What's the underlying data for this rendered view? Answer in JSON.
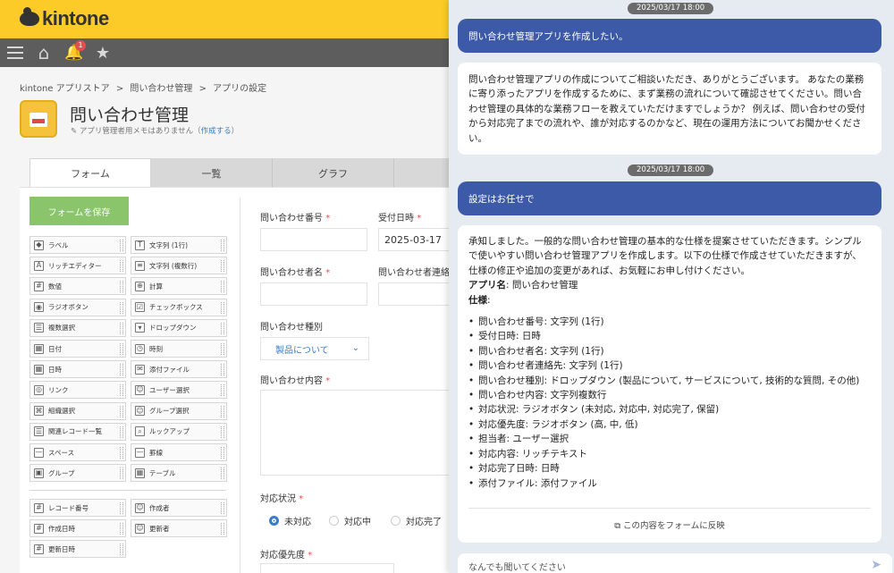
{
  "header": {
    "logo_text": "kintone",
    "notification_count": "1"
  },
  "breadcrumb": [
    "kintone アプリストア",
    ">",
    "問い合わせ管理",
    ">",
    "アプリの設定"
  ],
  "app": {
    "title": "問い合わせ管理",
    "memo": "アプリ管理者用メモはありません（",
    "memo_link": "作成する",
    "memo_end": "）"
  },
  "tabs": [
    "フォーム",
    "一覧",
    "グラフ"
  ],
  "save_button": "フォームを保存",
  "parts_left": [
    "ラベル",
    "リッチエディター",
    "数値",
    "ラジオボタン",
    "複数選択",
    "日付",
    "日時",
    "リンク",
    "組織選択",
    "関連レコード一覧",
    "スペース",
    "グループ"
  ],
  "parts_right": [
    "文字列 (1行)",
    "文字列 (複数行)",
    "計算",
    "チェックボックス",
    "ドロップダウン",
    "時刻",
    "添付ファイル",
    "ユーザー選択",
    "グループ選択",
    "ルックアップ",
    "罫線",
    "テーブル"
  ],
  "parts_system_left": [
    "レコード番号",
    "作成日時",
    "更新日時"
  ],
  "parts_system_right": [
    "作成者",
    "更新者"
  ],
  "form": {
    "f1_label": "問い合わせ番号",
    "f2_label": "受付日時",
    "f2_value": "2025-03-17",
    "f3_label": "問い合わせ者名",
    "f4_label": "問い合わせ者連絡先",
    "f5_label": "問い合わせ種別",
    "f5_value": "製品について",
    "f6_label": "問い合わせ内容",
    "f7_label": "対応状況",
    "f7_options": [
      "未対応",
      "対応中",
      "対応完了"
    ],
    "f8_label": "対応優先度",
    "req": "*"
  },
  "chat": {
    "ts1": "2025/03/17 18:00",
    "user1": "問い合わせ管理アプリを作成したい。",
    "ai1": "問い合わせ管理アプリの作成についてご相談いただき、ありがとうございます。 あなたの業務に寄り添ったアプリを作成するために、まず業務の流れについて確認させてください。問い合わせ管理の具体的な業務フローを教えていただけますでしょうか？ 例えば、問い合わせの受付から対応完了までの流れや、誰が対応するのかなど、現在の運用方法についてお聞かせください。",
    "ts2": "2025/03/17 18:00",
    "user2": "設定はお任せで",
    "ai2_intro": "承知しました。一般的な問い合わせ管理の基本的な仕様を提案させていただきます。シンプルで使いやすい問い合わせ管理アプリを作成します。以下の仕様で作成させていただきますが、仕様の修正や追加の変更があれば、お気軽にお申し付けください。",
    "ai2_appname_label": "アプリ名",
    "ai2_appname": ": 問い合わせ管理",
    "ai2_spec_label": "仕様",
    "ai2_spec_colon": ":",
    "spec_items": [
      "問い合わせ番号: 文字列 (1行)",
      "受付日時: 日時",
      "問い合わせ者名: 文字列 (1行)",
      "問い合わせ者連絡先: 文字列 (1行)",
      "問い合わせ種別: ドロップダウン (製品について, サービスについて, 技術的な質問, その他)",
      "問い合わせ内容: 文字列複数行",
      "対応状況: ラジオボタン (未対応, 対応中, 対応完了, 保留)",
      "対応優先度: ラジオボタン (高, 中, 低)",
      "担当者: ユーザー選択",
      "対応内容: リッチテキスト",
      "対応完了日時: 日時",
      "添付ファイル: 添付ファイル"
    ],
    "reflect": "この内容をフォームに反映",
    "input_placeholder": "なんでも聞いてください"
  }
}
